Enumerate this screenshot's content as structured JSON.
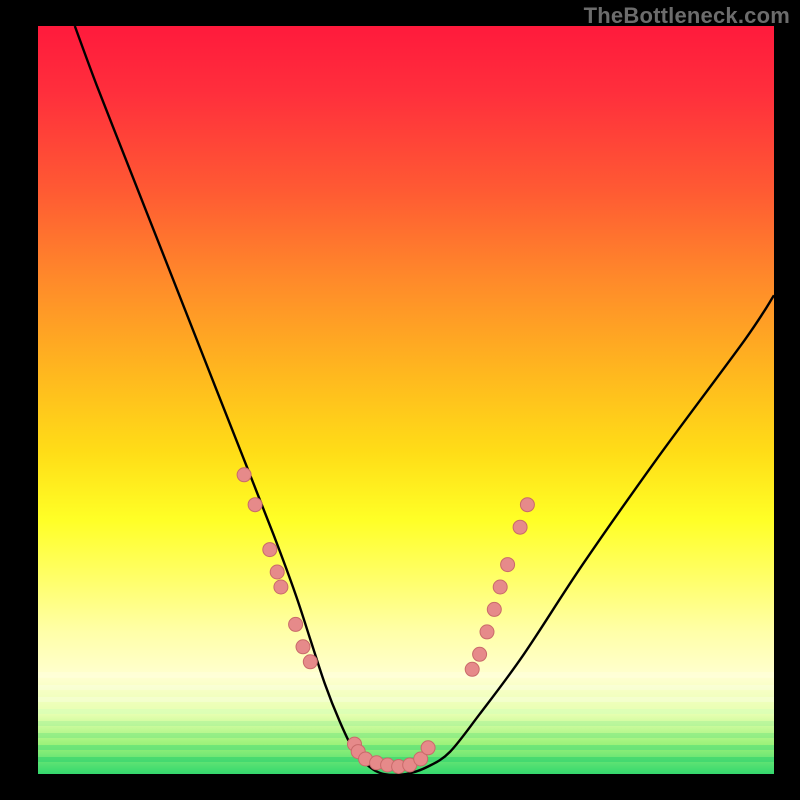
{
  "watermark": "TheBottleneck.com",
  "colors": {
    "background": "#000000",
    "gradient_top": "#ff1a3c",
    "gradient_mid": "#ffff26",
    "gradient_bottom": "#34d86e",
    "curve": "#000000",
    "marker_fill": "#e68a8a",
    "marker_stroke": "#c96a6a"
  },
  "chart_data": {
    "type": "line",
    "title": "",
    "xlabel": "",
    "ylabel": "",
    "xlim": [
      0,
      100
    ],
    "ylim": [
      0,
      100
    ],
    "grid": false,
    "legend": false,
    "series": [
      {
        "name": "bottleneck-curve",
        "x": [
          5,
          8,
          12,
          16,
          20,
          24,
          28,
          32,
          35,
          37,
          39,
          41,
          43,
          45,
          47,
          50,
          53,
          56,
          60,
          66,
          74,
          84,
          96,
          100
        ],
        "y": [
          100,
          92,
          82,
          72,
          62,
          52,
          42,
          32,
          24,
          18,
          12,
          7,
          3,
          1,
          0,
          0,
          1,
          3,
          8,
          16,
          28,
          42,
          58,
          64
        ]
      }
    ],
    "markers": [
      {
        "x": 28,
        "y": 40
      },
      {
        "x": 29.5,
        "y": 36
      },
      {
        "x": 31.5,
        "y": 30
      },
      {
        "x": 32.5,
        "y": 27
      },
      {
        "x": 33,
        "y": 25
      },
      {
        "x": 35,
        "y": 20
      },
      {
        "x": 36,
        "y": 17
      },
      {
        "x": 37,
        "y": 15
      },
      {
        "x": 43,
        "y": 4
      },
      {
        "x": 43.5,
        "y": 3
      },
      {
        "x": 44.5,
        "y": 2
      },
      {
        "x": 46,
        "y": 1.5
      },
      {
        "x": 47.5,
        "y": 1.2
      },
      {
        "x": 49,
        "y": 1.0
      },
      {
        "x": 50.5,
        "y": 1.2
      },
      {
        "x": 52,
        "y": 2
      },
      {
        "x": 53,
        "y": 3.5
      },
      {
        "x": 59,
        "y": 14
      },
      {
        "x": 60,
        "y": 16
      },
      {
        "x": 61,
        "y": 19
      },
      {
        "x": 62,
        "y": 22
      },
      {
        "x": 62.8,
        "y": 25
      },
      {
        "x": 63.8,
        "y": 28
      },
      {
        "x": 65.5,
        "y": 33
      },
      {
        "x": 66.5,
        "y": 36
      }
    ]
  }
}
